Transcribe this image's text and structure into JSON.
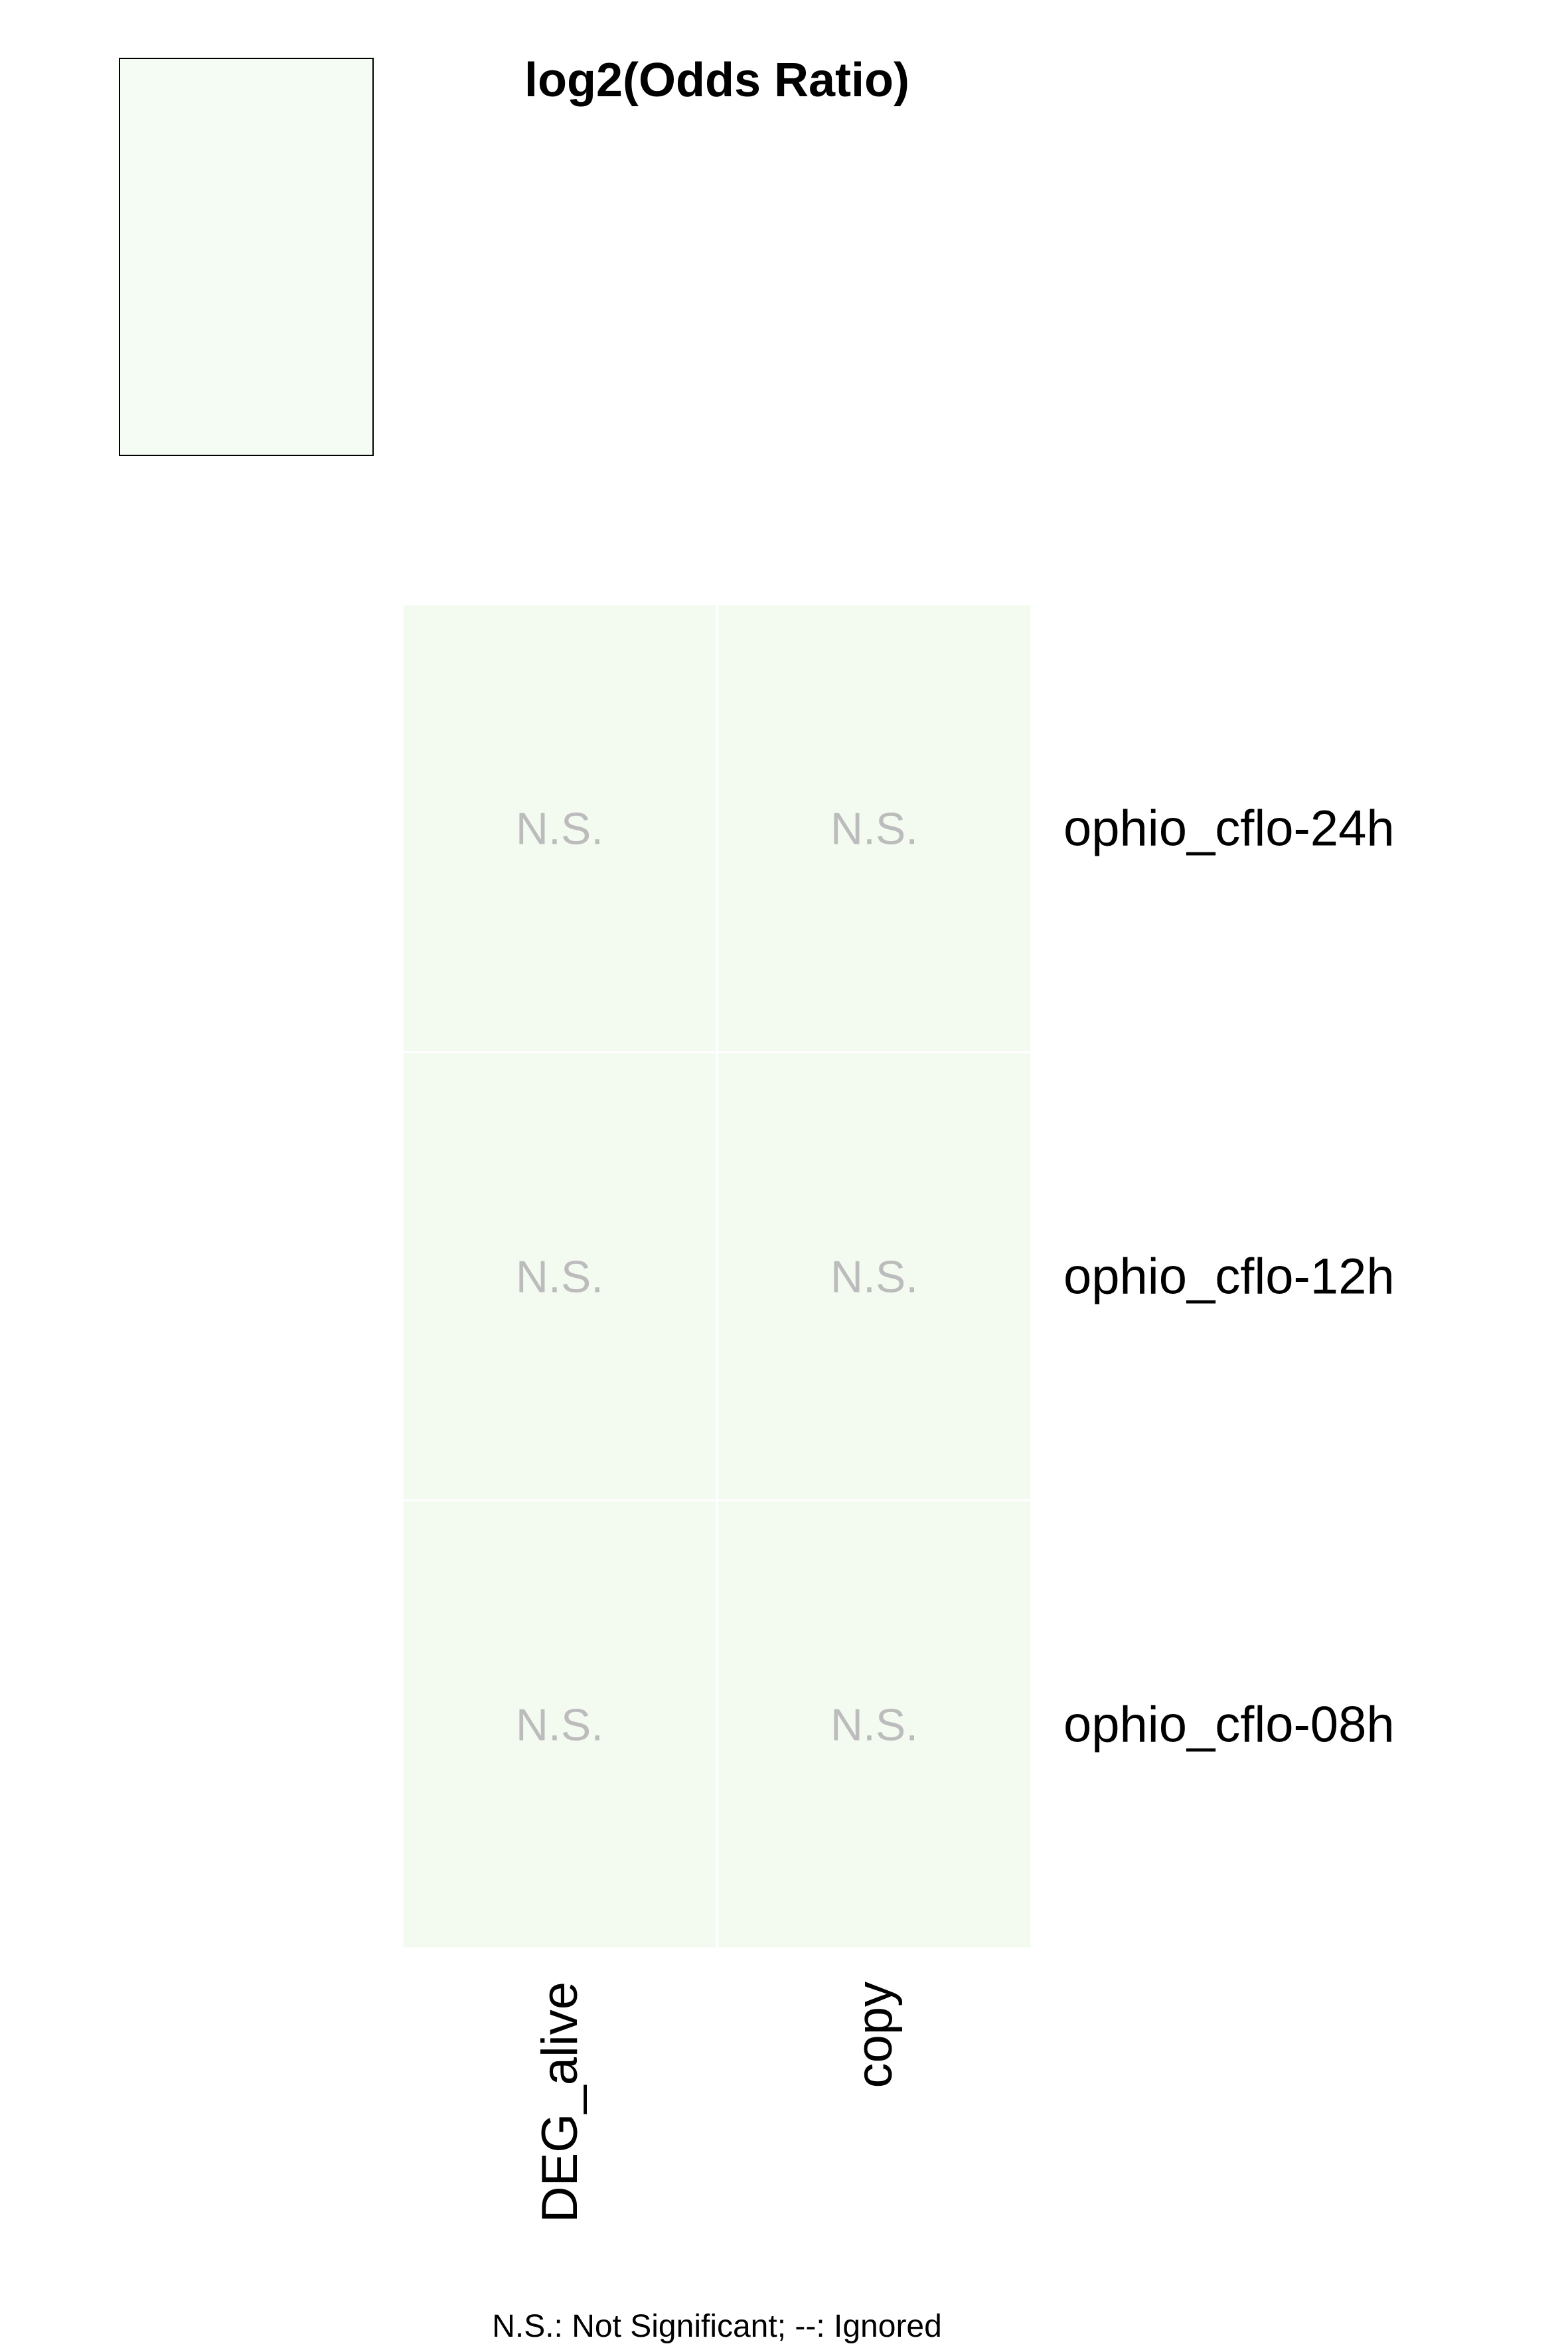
{
  "chart_data": {
    "type": "heatmap",
    "title": "log2(Odds Ratio)",
    "columns": [
      "DEG_alive",
      "copy"
    ],
    "rows": [
      "ophio_cflo-24h",
      "ophio_cflo-12h",
      "ophio_cflo-08h"
    ],
    "cells": [
      [
        "N.S.",
        "N.S."
      ],
      [
        "N.S.",
        "N.S."
      ],
      [
        "N.S.",
        "N.S."
      ]
    ],
    "footnote": "N.S.: Not Significant; --: Ignored",
    "colors": {
      "cell_fill": "#f3fbf1",
      "legend_fill": "#f5fcf3",
      "cell_text": "#bcbcbc",
      "grid_line": "#ffffff",
      "label_text": "#000000"
    }
  }
}
